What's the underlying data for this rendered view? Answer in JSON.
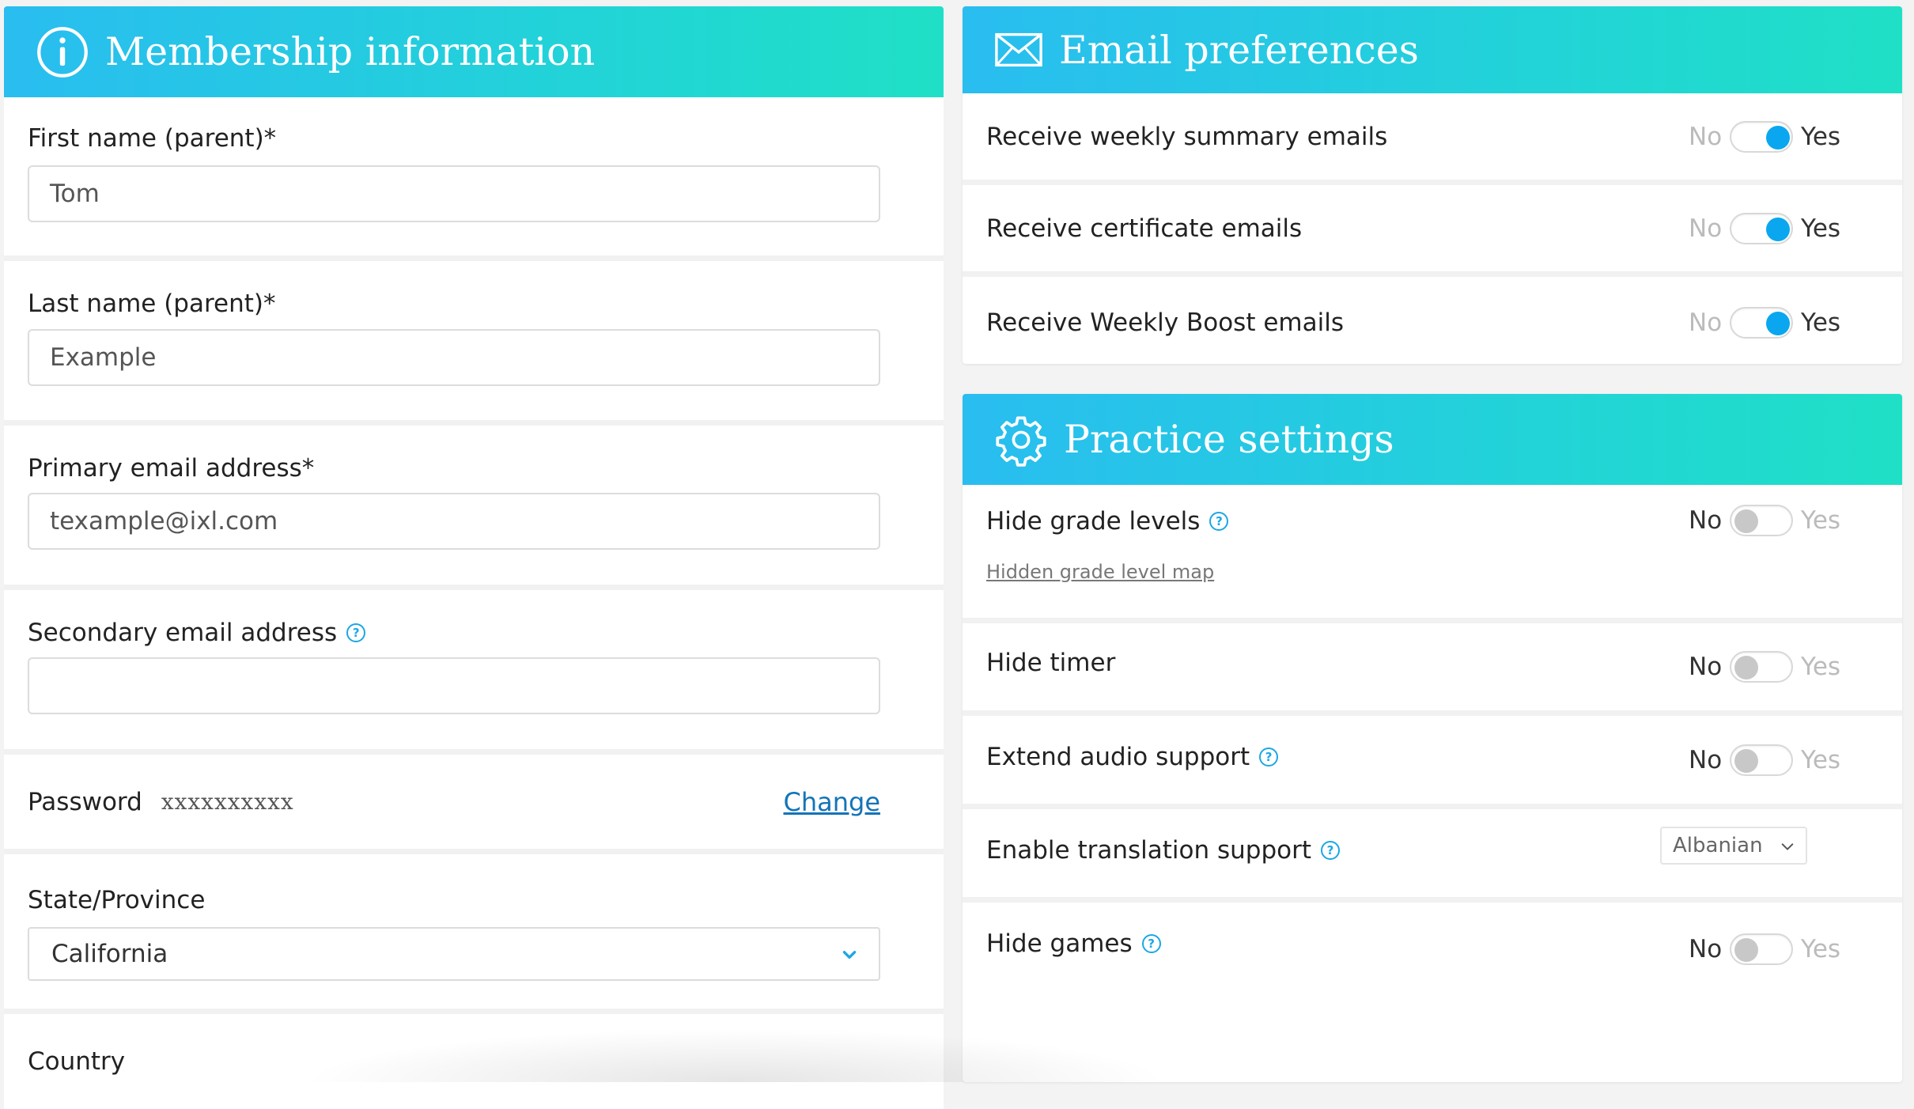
{
  "membership": {
    "title": "Membership information",
    "first_name_label": "First name (parent)*",
    "first_name_value": "Tom",
    "last_name_label": "Last name (parent)*",
    "last_name_value": "Example",
    "primary_email_label": "Primary email address*",
    "primary_email_value": "texample@ixl.com",
    "secondary_email_label": "Secondary email address",
    "secondary_email_value": "",
    "password_label": "Password",
    "password_mask": "xxxxxxxxxx",
    "change_link": "Change",
    "state_label": "State/Province",
    "state_value": "California",
    "country_label": "Country",
    "help_mark": "?"
  },
  "email_prefs": {
    "title": "Email preferences",
    "no_label": "No",
    "yes_label": "Yes",
    "rows": [
      {
        "label": "Receive weekly summary emails",
        "enabled": true
      },
      {
        "label": "Receive certificate emails",
        "enabled": true
      },
      {
        "label": "Receive Weekly Boost emails",
        "enabled": true
      }
    ]
  },
  "practice": {
    "title": "Practice settings",
    "no_label": "No",
    "yes_label": "Yes",
    "hide_grade_levels": "Hide grade levels",
    "hidden_grade_map_link": "Hidden grade level map",
    "hide_timer": "Hide timer",
    "extend_audio": "Extend audio support",
    "enable_translation": "Enable translation support",
    "translation_language": "Albanian",
    "hide_games": "Hide games",
    "help_mark": "?",
    "toggles": {
      "hide_grade_levels": false,
      "hide_timer": false,
      "extend_audio": false,
      "hide_games": false
    }
  },
  "colors": {
    "accent": "#0aa7f0",
    "link": "#1474b8",
    "header_start": "#29bdf0",
    "header_end": "#1fe0c6"
  }
}
